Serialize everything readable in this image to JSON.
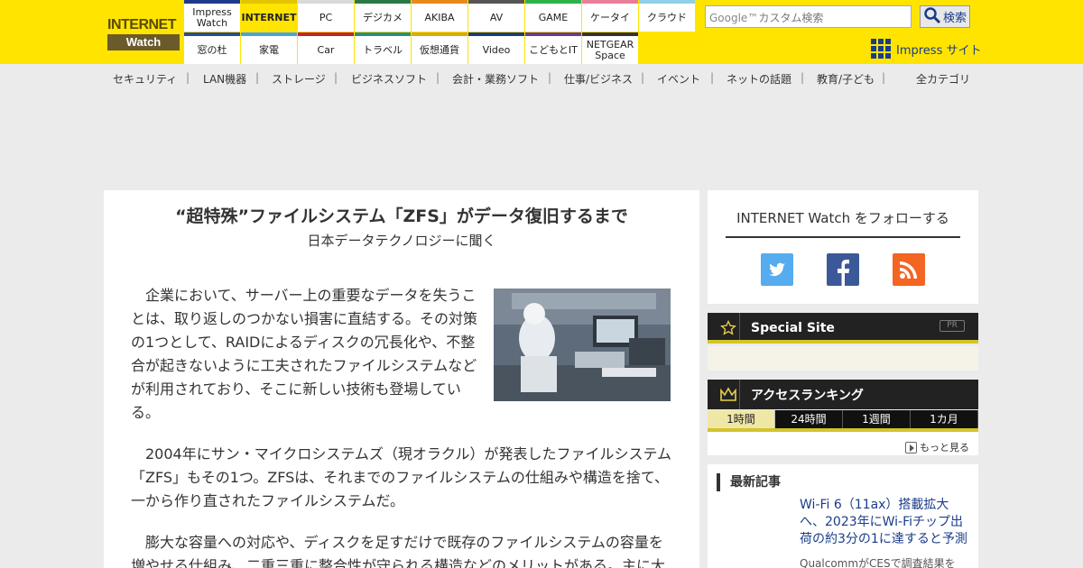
{
  "header": {
    "logo_top": "INTERNET",
    "logo_bottom": "Watch",
    "nav_top": [
      "Impress Watch",
      "INTERNET",
      "PC",
      "デジカメ",
      "AKIBA",
      "AV",
      "GAME",
      "ケータイ",
      "クラウド"
    ],
    "nav_bottom": [
      "窓の杜",
      "家電",
      "Car",
      "トラベル",
      "仮想通貨",
      "Video",
      "こどもとIT",
      "NETGEAR Space"
    ],
    "nav_top_colors": [
      "#1f3a8a",
      "#e2c400",
      "#d9d9d9",
      "#2a7a48",
      "#e88a1a",
      "#555555",
      "#2db34a",
      "#e87d9a",
      "#8fd0e8"
    ],
    "nav_bottom_colors": [
      "#2a4a9a",
      "#4aa3df",
      "#c0262d",
      "#2a8a8a",
      "#d9a81a",
      "#1a3c8a",
      "#6a3a9a",
      "#333333"
    ],
    "search_placeholder": "カスタム検索",
    "search_google": "Google™",
    "search_button": "検索",
    "impress_link": "Impress サイト"
  },
  "categories": [
    "セキュリティ",
    "LAN機器",
    "ストレージ",
    "ビジネスソフト",
    "会計・業務ソフト",
    "仕事/ビジネス",
    "イベント",
    "ネットの話題",
    "教育/子ども"
  ],
  "all_categories": "全カテゴリ",
  "article": {
    "title": "“超特殊”ファイルシステム「ZFS」がデータ復旧するまで",
    "subtitle": "日本データテクノロジーに聞く",
    "para1": "企業において、サーバー上の重要なデータを失うことは、取り返しのつかない損害に直結する。その対策の1つとして、RAIDによるディスクの冗長化や、不整合が起きないように工夫されたファイルシステムなどが利用されており、そこに新しい技術も登場している。",
    "para2": "2004年にサン・マイクロシステムズ（現オラクル）が発表したファイルシステム「ZFS」もその1つ。ZFSは、それまでのファイルシステムの仕組みや構造を捨て、一から作り直されたファイルシステムだ。",
    "para3": "膨大な容量への対応や、ディスクを足すだけで既存のファイルシステムの容量を増やせる仕組み、二重三重に整合性が守られる構造などのメリットがある。主に大"
  },
  "sidebar": {
    "follow_title": "INTERNET Watch をフォローする",
    "special_title": "Special Site",
    "pr_label": "PR",
    "ranking_title": "アクセスランキング",
    "ranking_tabs": [
      "1時間",
      "24時間",
      "1週間",
      "1カ月"
    ],
    "more_label": "もっと見る",
    "latest_head": "最新記事",
    "latest_title": "Wi-Fi 6（11ax）搭載拡大へ、2023年にWi-Fiチップ出荷の約3分の1に達すると予測",
    "latest_desc": "QualcommがCESで調査結果を"
  }
}
